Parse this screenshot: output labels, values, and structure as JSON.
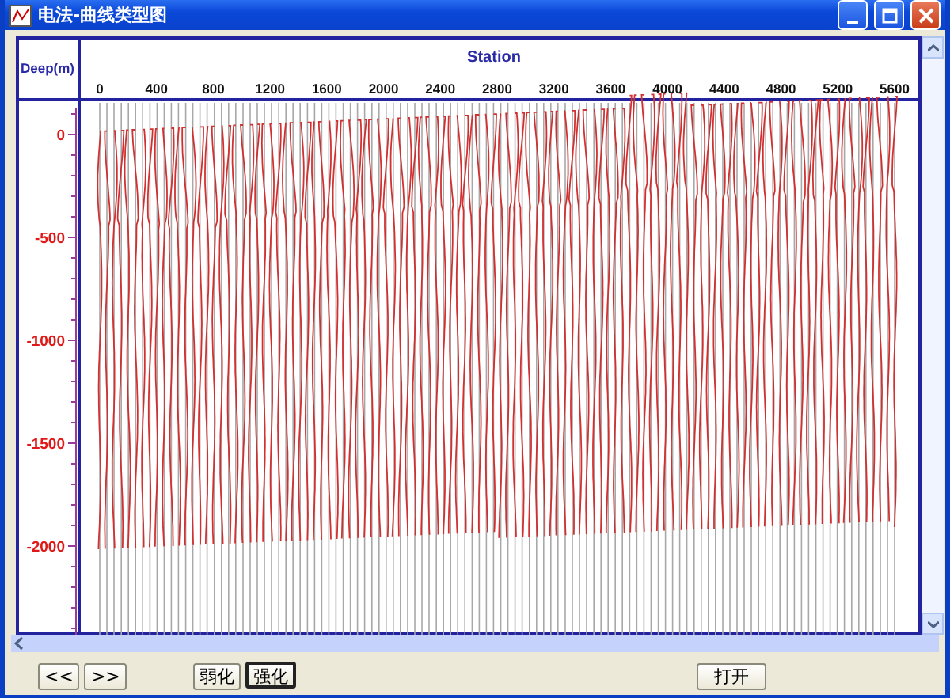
{
  "window": {
    "title": "电法-曲线类型图"
  },
  "chart": {
    "x_title": "Station",
    "y_title": "Deep(m)",
    "x_ticks": [
      "0",
      "400",
      "800",
      "1200",
      "1600",
      "2000",
      "2400",
      "2800",
      "3200",
      "3600",
      "4000",
      "4400",
      "4800",
      "5200",
      "5600"
    ],
    "y_ticks": [
      "0",
      "-500",
      "-1000",
      "-1500",
      "-2000"
    ]
  },
  "button_groups": [
    {
      "buttons": [
        {
          "label": "<<",
          "selected": false
        },
        {
          "label": ">>",
          "selected": false
        }
      ]
    },
    {
      "buttons": [
        {
          "label": "弱化",
          "selected": false
        },
        {
          "label": "强化",
          "selected": true
        }
      ]
    },
    {
      "buttons": [
        {
          "label": "打开",
          "selected": false
        }
      ]
    }
  ]
}
